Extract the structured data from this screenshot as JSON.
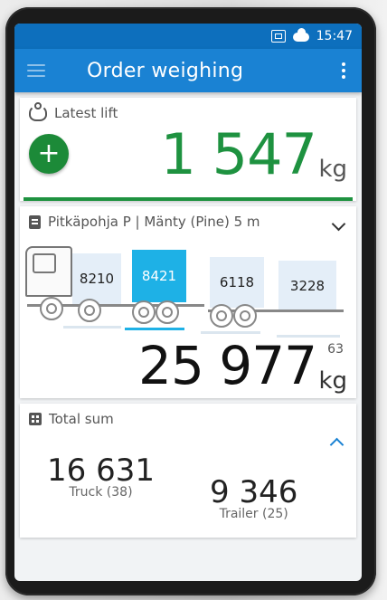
{
  "status": {
    "time": "15:47"
  },
  "appbar": {
    "title": "Order weighing"
  },
  "latest_lift": {
    "header": "Latest lift",
    "add_label": "+",
    "value": "1 547",
    "unit": "kg"
  },
  "load": {
    "header": "Pitkäpohja P | Mänty (Pine) 5 m",
    "axles": [
      {
        "value": "8210",
        "active": false
      },
      {
        "value": "8421",
        "active": true
      },
      {
        "value": "6118",
        "active": false
      },
      {
        "value": "3228",
        "active": false
      }
    ],
    "gross": "25 977",
    "gross_small": "63",
    "unit": "kg"
  },
  "total": {
    "header": "Total sum",
    "truck": {
      "value": "16 631",
      "label": "Truck (38)"
    },
    "trailer": {
      "value": "9 346",
      "label": "Trailer (25)"
    }
  },
  "colors": {
    "appbar": "#1a82d3",
    "statusbar": "#0d6fbd",
    "lift_green": "#1e9240",
    "active_axle": "#1eb1e6"
  }
}
